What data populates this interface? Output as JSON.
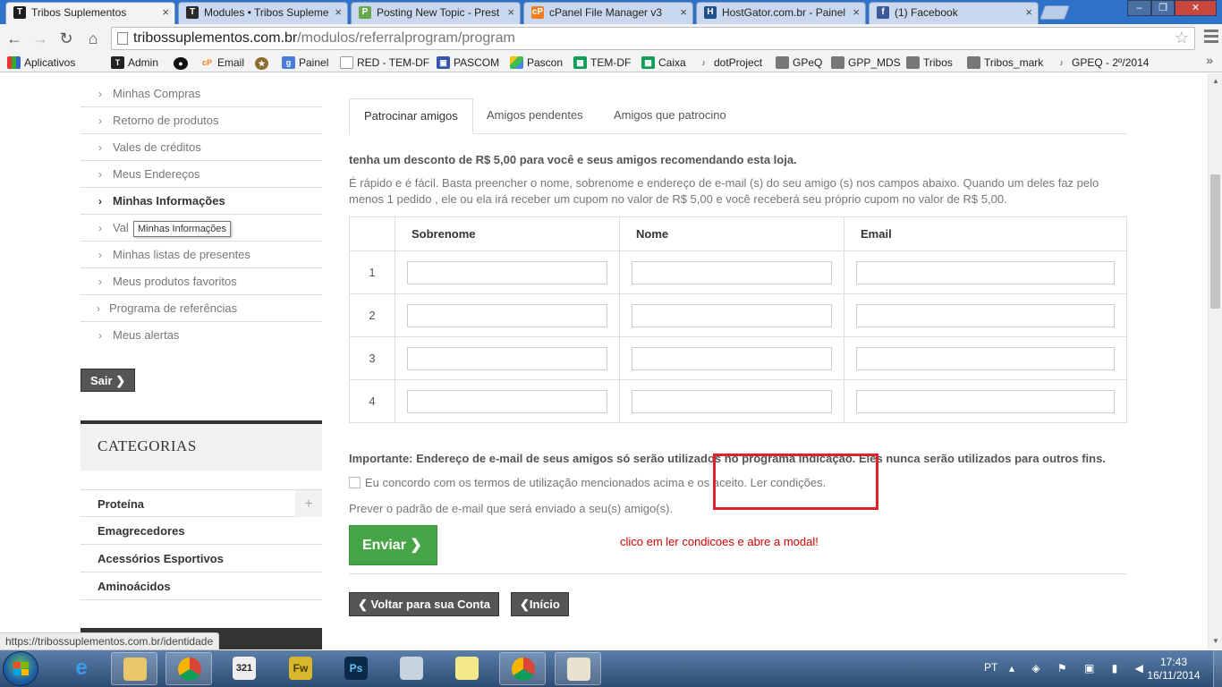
{
  "browser": {
    "tabs": [
      {
        "label": "Tribos Suplementos",
        "active": true
      },
      {
        "label": "Modules • Tribos Supleme",
        "active": false
      },
      {
        "label": "Posting New Topic - Prest",
        "active": false
      },
      {
        "label": "cPanel File Manager v3",
        "active": false
      },
      {
        "label": "HostGator.com.br - Painel",
        "active": false
      },
      {
        "label": "(1) Facebook",
        "active": false
      }
    ],
    "url_host": "tribossuplementos.com.br",
    "url_path": "/modulos/referralprogram/program",
    "bookmarks": [
      "Aplicativos",
      "Admin",
      "Email",
      "Painel",
      "RED - TEM-DF",
      "PASCOM",
      "Pascon",
      "TEM-DF",
      "Caixa",
      "dotProject",
      "GPeQ",
      "GPP_MDS",
      "Tribos",
      "Tribos_mark",
      "GPEQ - 2º/2014"
    ],
    "status_url": "https://tribossuplementos.com.br/identidade"
  },
  "sidebar": {
    "items": [
      {
        "label": "Minhas Compras"
      },
      {
        "label": "Retorno de produtos"
      },
      {
        "label": "Vales de créditos"
      },
      {
        "label": "Meus Endereços"
      },
      {
        "label": "Minhas Informações"
      },
      {
        "label": "Val"
      },
      {
        "label": "Minhas listas de presentes"
      },
      {
        "label": "Meus produtos favoritos"
      },
      {
        "label": "Programa de referências"
      },
      {
        "label": "Meus alertas"
      }
    ],
    "tooltip": "Minhas Informações",
    "logout_label": "Sair",
    "categories_title": "CATEGORIAS",
    "categories": [
      {
        "label": "Proteína"
      },
      {
        "label": "Emagrecedores"
      },
      {
        "label": "Acessórios Esportivos"
      },
      {
        "label": "Aminoácidos"
      }
    ]
  },
  "main": {
    "tabs": [
      "Patrocinar amigos",
      "Amigos pendentes",
      "Amigos que patrocino"
    ],
    "headline": "tenha um desconto de R$ 5,00 para você e seus amigos recomendando esta loja.",
    "description": "É rápido e é fácil. Basta preencher o nome, sobrenome e endereço de e-mail (s) do seu amigo (s) nos campos abaixo. Quando um deles faz pelo menos 1 pedido , ele ou ela irá receber um cupom no valor de R$ 5,00 e você receberá seu próprio cupom no valor de R$ 5,00.",
    "table_headers": [
      "Sobrenome",
      "Nome",
      "Email"
    ],
    "rows": [
      "1",
      "2",
      "3",
      "4"
    ],
    "important": "Importante: Endereço de e-mail de seus amigos só serão utilizados no programa Indicação. Eles nunca serão utilizados para outros fins.",
    "agree_text": "Eu concordo com os termos de utilização mencionados acima e os aceito. Ler condições.",
    "preview_text": "Prever o padrão de e-mail que será enviado a seu(s) amigo(s).",
    "send_label": "Enviar",
    "annotation": "clico em ler condicoes e abre a modal!",
    "back_account_label": "Voltar para sua Conta",
    "home_label": "Início"
  },
  "taskbar": {
    "language": "PT",
    "time": "17:43",
    "date": "16/11/2014"
  }
}
